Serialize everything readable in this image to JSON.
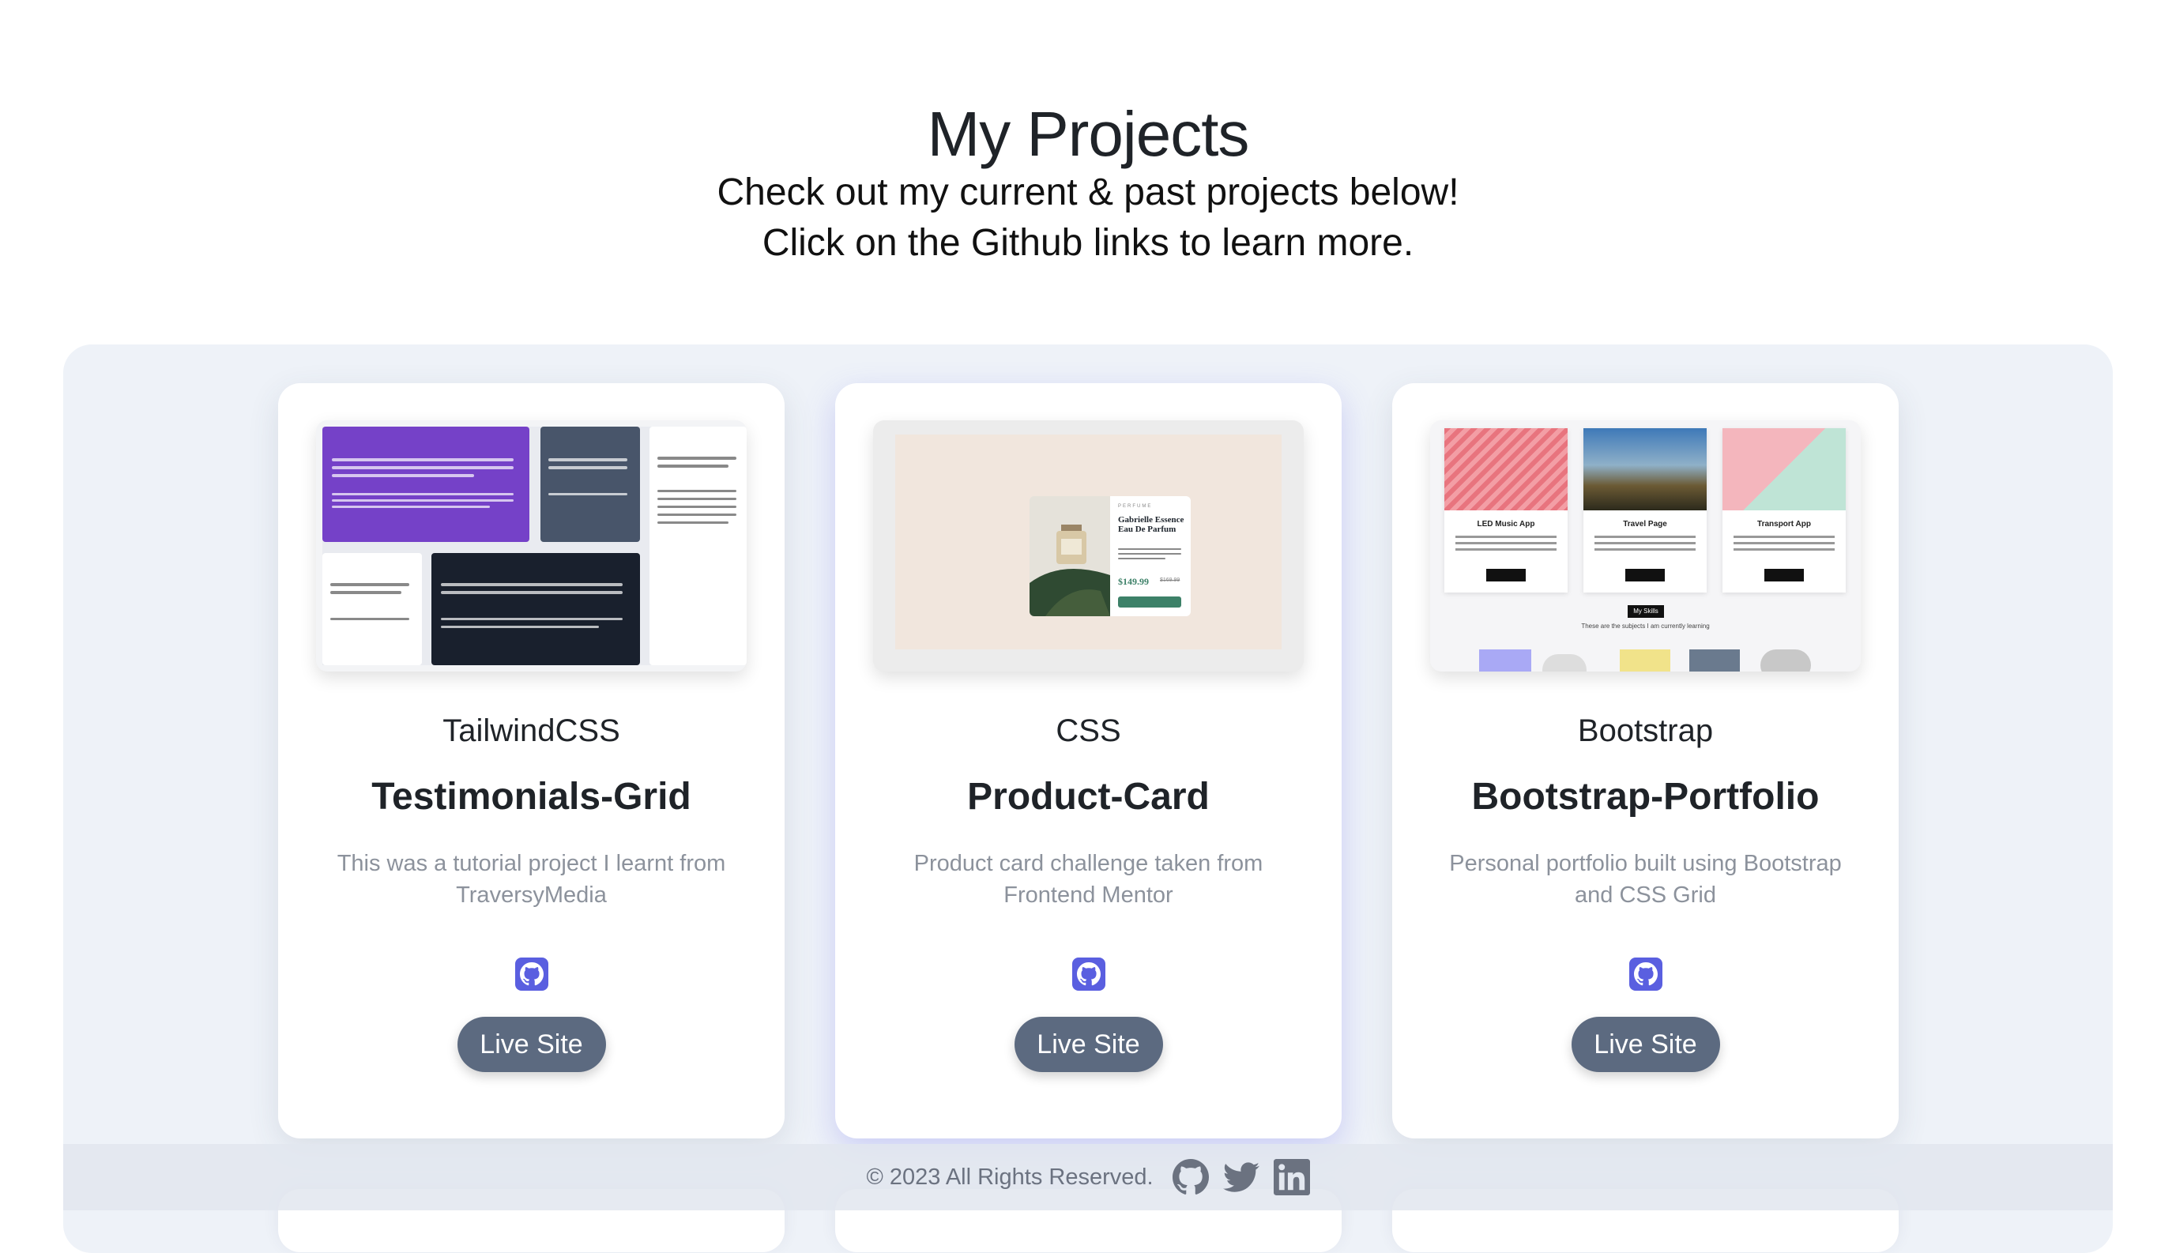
{
  "header": {
    "title": "My Projects",
    "intro_line1": "Check out my current & past projects below!",
    "intro_line2": "Click on the Github links to learn more."
  },
  "projects": [
    {
      "tech": "TailwindCSS",
      "title": "Testimonials-Grid",
      "description": "This was a tutorial project I learnt from TraversyMedia",
      "icon": "github-icon",
      "live_label": "Live Site"
    },
    {
      "tech": "CSS",
      "title": "Product-Card",
      "description": "Product card challenge taken from Frontend Mentor",
      "icon": "github-icon",
      "live_label": "Live Site",
      "thumb": {
        "category": "PERFUME",
        "name": "Gabrielle Essence Eau De Parfum",
        "price": "$149.99",
        "old_price": "$169.99"
      }
    },
    {
      "tech": "Bootstrap",
      "title": "Bootstrap-Portfolio",
      "description": "Personal portfolio built using Bootstrap and CSS Grid",
      "icon": "github-icon",
      "live_label": "Live Site",
      "thumb": {
        "cards": [
          "LED Music App",
          "Travel Page",
          "Transport App"
        ],
        "button": "Visit Page",
        "skills_label": "My Skills",
        "skills_text": "These are the subjects I am currently learning"
      }
    }
  ],
  "footer": {
    "copyright": "© 2023 All Rights Reserved.",
    "icons": [
      "github-icon",
      "twitter-icon",
      "linkedin-icon"
    ]
  },
  "colors": {
    "accent": "#5a5fe0",
    "button": "#5c6a80",
    "panel": "#eef2f8"
  }
}
